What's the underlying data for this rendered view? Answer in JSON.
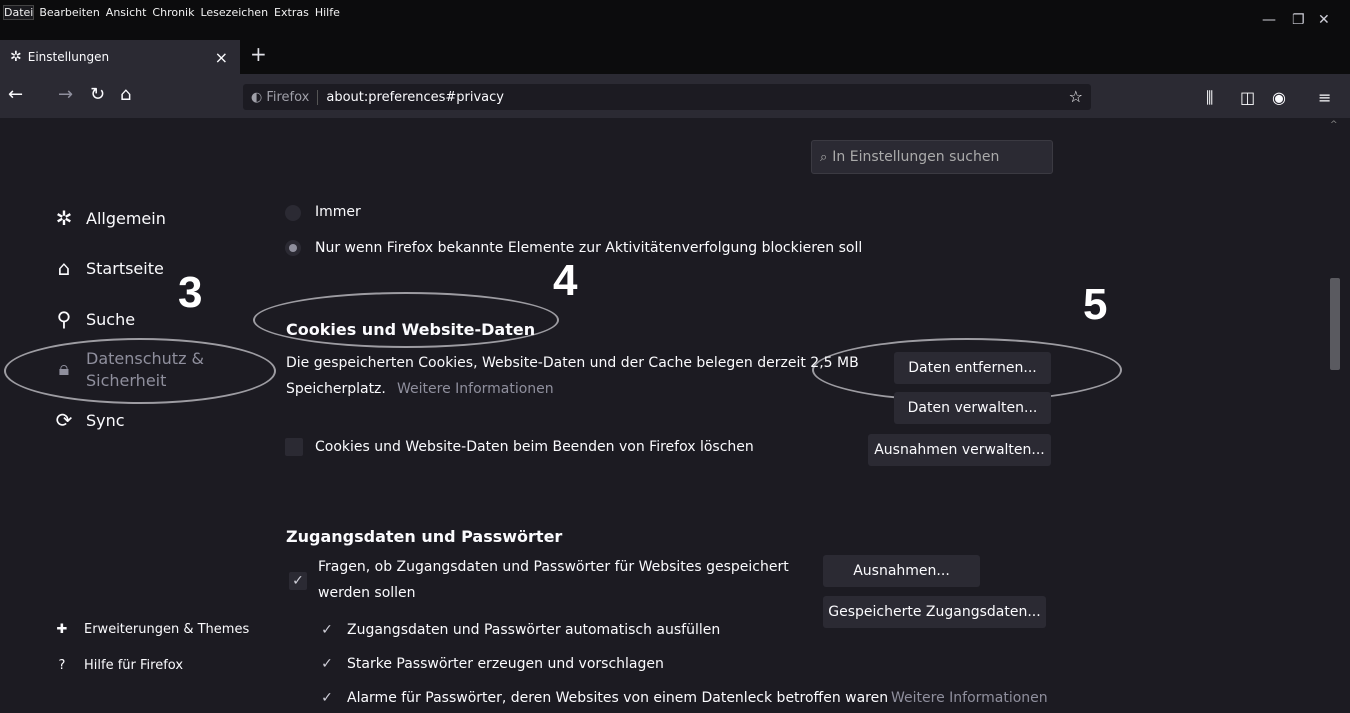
{
  "menu": [
    "Datei",
    "Bearbeiten",
    "Ansicht",
    "Chronik",
    "Lesezeichen",
    "Extras",
    "Hilfe"
  ],
  "tab": {
    "title": "Einstellungen",
    "close": "×",
    "new": "+"
  },
  "url": {
    "browser_label": "Firefox",
    "address": "about:preferences#privacy"
  },
  "search": {
    "placeholder": "In Einstellungen suchen"
  },
  "sidebar": {
    "items": [
      "Allgemein",
      "Startseite",
      "Suche",
      "Datenschutz &",
      "Sicherheit",
      "Sync"
    ],
    "bottom": [
      "Erweiterungen & Themes",
      "Hilfe für Firefox"
    ]
  },
  "annotations": [
    "3",
    "4",
    "5"
  ],
  "dnt": {
    "option_always": "Immer",
    "option_only": "Nur wenn Firefox bekannte Elemente zur Aktivitätenverfolgung blockieren soll"
  },
  "cookies": {
    "heading": "Cookies und Website-Daten",
    "description_line1": "Die gespeicherten Cookies, Website-Daten und der Cache belegen derzeit 2,5 MB",
    "description_line2": "Speicherplatz.",
    "more_info": "Weitere Informationen",
    "btn_remove": "Daten entfernen...",
    "btn_manage": "Daten verwalten...",
    "btn_exceptions": "Ausnahmen verwalten...",
    "delete_on_close": "Cookies und Website-Daten beim Beenden von Firefox löschen"
  },
  "logins": {
    "heading": "Zugangsdaten und Passwörter",
    "ask_line1": "Fragen, ob Zugangsdaten und Passwörter für Websites gespeichert",
    "ask_line2": "werden sollen",
    "btn_exceptions": "Ausnahmen...",
    "btn_saved": "Gespeicherte Zugangsdaten...",
    "autofill": "Zugangsdaten und Passwörter automatisch ausfüllen",
    "suggest": "Starke Passwörter erzeugen und vorschlagen",
    "alerts": "Alarme für Passwörter, deren Websites von einem Datenleck betroffen waren",
    "more_info": "Weitere Informationen"
  }
}
